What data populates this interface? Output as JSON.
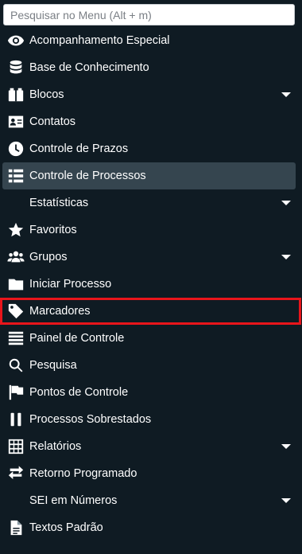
{
  "search": {
    "placeholder": "Pesquisar no Menu (Alt + m)"
  },
  "items": [
    {
      "label": "Acompanhamento Especial",
      "icon": "eye-icon",
      "has_submenu": false
    },
    {
      "label": "Base de Conhecimento",
      "icon": "database-icon",
      "has_submenu": false
    },
    {
      "label": "Blocos",
      "icon": "blocks-icon",
      "has_submenu": true
    },
    {
      "label": "Contatos",
      "icon": "contact-card-icon",
      "has_submenu": false
    },
    {
      "label": "Controle de Prazos",
      "icon": "clock-icon",
      "has_submenu": false
    },
    {
      "label": "Controle de Processos",
      "icon": "list-icon",
      "has_submenu": false,
      "state": "active"
    },
    {
      "label": "Estatísticas",
      "icon": "",
      "has_submenu": true
    },
    {
      "label": "Favoritos",
      "icon": "star-icon",
      "has_submenu": false
    },
    {
      "label": "Grupos",
      "icon": "users-icon",
      "has_submenu": true
    },
    {
      "label": "Iniciar Processo",
      "icon": "folder-icon",
      "has_submenu": false
    },
    {
      "label": "Marcadores",
      "icon": "tag-icon",
      "has_submenu": false,
      "state": "highlighted"
    },
    {
      "label": "Painel de Controle",
      "icon": "panel-lines-icon",
      "has_submenu": false
    },
    {
      "label": "Pesquisa",
      "icon": "search-icon",
      "has_submenu": false
    },
    {
      "label": "Pontos de Controle",
      "icon": "flag-icon",
      "has_submenu": false
    },
    {
      "label": "Processos Sobrestados",
      "icon": "pause-icon",
      "has_submenu": false
    },
    {
      "label": "Relatórios",
      "icon": "table-icon",
      "has_submenu": true
    },
    {
      "label": "Retorno Programado",
      "icon": "exchange-arrows-icon",
      "has_submenu": false
    },
    {
      "label": "SEI em Números",
      "icon": "",
      "has_submenu": true
    },
    {
      "label": "Textos Padrão",
      "icon": "document-icon",
      "has_submenu": false
    }
  ],
  "colors": {
    "background": "#0f1b23",
    "active_background": "#35454f",
    "highlight_border": "#e8151b",
    "text": "#ffffff"
  }
}
